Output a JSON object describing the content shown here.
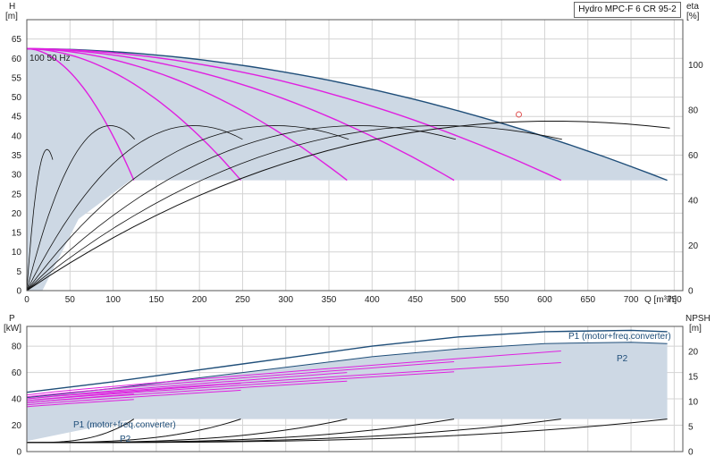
{
  "chart_data": [
    {
      "type": "line",
      "title": "Hydro MPC-F 6 CR 95-2",
      "xlabel": "Q [m³/h]",
      "ylabel": "H",
      "ylabel_unit": "[m]",
      "y2label": "eta",
      "y2label_unit": "[%]",
      "xlim": [
        0,
        760
      ],
      "ylim": [
        0,
        70
      ],
      "y2lim": [
        0,
        120
      ],
      "x_ticks": [
        0,
        50,
        100,
        150,
        200,
        250,
        300,
        350,
        400,
        450,
        500,
        550,
        600,
        650,
        700,
        750
      ],
      "y_ticks": [
        0,
        5,
        10,
        15,
        20,
        25,
        30,
        35,
        40,
        45,
        50,
        55,
        60,
        65
      ],
      "y2_ticks": [
        0,
        20,
        40,
        60,
        80,
        100
      ],
      "grid": true,
      "annotation": "100 50 Hz",
      "duty_point": {
        "q": 570,
        "h": 45.5
      },
      "envelope_min_head": 28.5,
      "series": [
        {
          "pumps": 6,
          "shutoff_head": 62.5,
          "q_max": 742,
          "h_end": 28.5,
          "full_speed": true
        },
        {
          "pumps": 5,
          "shutoff_head": 62.5,
          "q_max": 619,
          "h_end": 28.5
        },
        {
          "pumps": 4,
          "shutoff_head": 62.5,
          "q_max": 495,
          "h_end": 28.5
        },
        {
          "pumps": 3,
          "shutoff_head": 62.5,
          "q_max": 371,
          "h_end": 28.5
        },
        {
          "pumps": 2,
          "shutoff_head": 62.5,
          "q_max": 248,
          "h_end": 28.5
        },
        {
          "pumps": 1,
          "shutoff_head": 62.5,
          "q_max": 124,
          "h_end": 28.5
        }
      ],
      "efficiency_curves": [
        {
          "q_max": 745,
          "peak": 80,
          "end": 72
        },
        {
          "q_max": 620,
          "peak": 80,
          "end": 67
        },
        {
          "q_max": 497,
          "peak": 80,
          "end": 67
        },
        {
          "q_max": 373,
          "peak": 80,
          "end": 67
        },
        {
          "q_max": 250,
          "peak": 80,
          "end": 67
        },
        {
          "q_max": 125,
          "peak": 80,
          "end": 67
        },
        {
          "q_max": 30,
          "peak": 68,
          "end": 58
        }
      ]
    },
    {
      "type": "line",
      "ylabel": "P",
      "ylabel_unit": "[kW]",
      "y2label": "NPSH",
      "y2label_unit": "[m]",
      "xlim": [
        0,
        760
      ],
      "ylim": [
        0,
        95
      ],
      "y2lim": [
        0,
        25
      ],
      "y_ticks": [
        0,
        20,
        40,
        60,
        80
      ],
      "y2_ticks": [
        0,
        5,
        10,
        15,
        20
      ],
      "grid": true,
      "labels": {
        "p1_top": "P1 (motor+freq.converter)",
        "p2_top": "P2",
        "p1_bottom": "P1 (motor+freq.converter)",
        "p2_bottom": "P2"
      },
      "p1_full": {
        "q": [
          0,
          100,
          200,
          300,
          400,
          500,
          600,
          700,
          742
        ],
        "p": [
          45,
          53,
          62,
          71,
          80,
          87,
          91,
          92,
          91
        ]
      },
      "p2_full": {
        "q": [
          0,
          100,
          200,
          300,
          400,
          500,
          600,
          700,
          742
        ],
        "p": [
          41,
          48,
          56,
          64,
          72,
          78,
          82,
          83,
          82
        ]
      },
      "npsh_ends": [
        {
          "q": 124,
          "npsh": 6.5
        },
        {
          "q": 248,
          "npsh": 6.5
        },
        {
          "q": 371,
          "npsh": 6.5
        },
        {
          "q": 495,
          "npsh": 6.5
        },
        {
          "q": 619,
          "npsh": 6.5
        },
        {
          "q": 742,
          "npsh": 6.5
        }
      ]
    }
  ]
}
